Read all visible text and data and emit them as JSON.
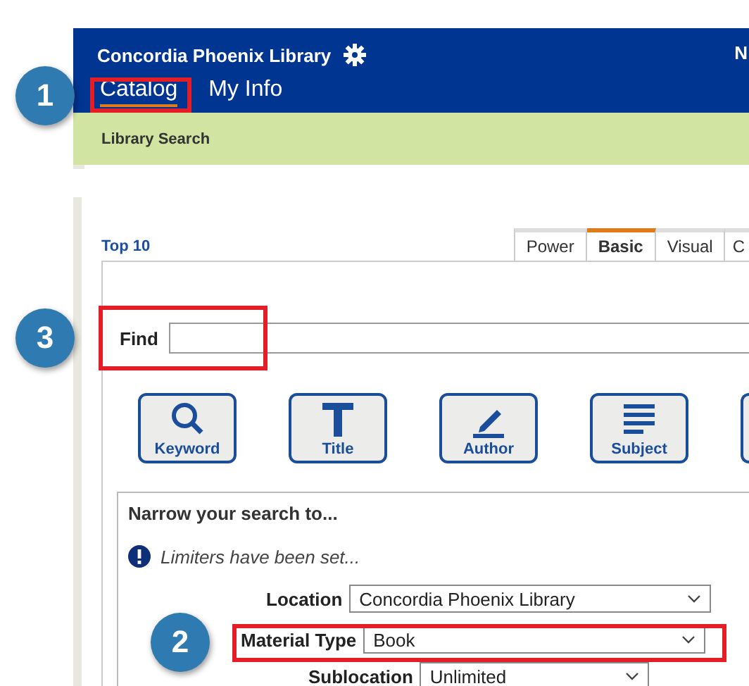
{
  "header": {
    "title": "Concordia Phoenix Library",
    "corner_text": "N"
  },
  "nav": [
    {
      "label": "Catalog",
      "selected": true
    },
    {
      "label": "My Info",
      "selected": false
    }
  ],
  "breadcrumb": "Library Search",
  "top_link": "Top 10",
  "tabs": [
    {
      "label": "Power",
      "selected": false
    },
    {
      "label": "Basic",
      "selected": true
    },
    {
      "label": "Visual",
      "selected": false
    },
    {
      "label": "C",
      "selected": false
    }
  ],
  "find": {
    "label": "Find"
  },
  "search_buttons": [
    {
      "label": "Keyword",
      "kind": "keyword"
    },
    {
      "label": "Title",
      "kind": "title"
    },
    {
      "label": "Author",
      "kind": "author"
    },
    {
      "label": "Subject",
      "kind": "subject"
    }
  ],
  "narrow": {
    "title": "Narrow your search to...",
    "notice": "Limiters have been set...",
    "limiters": [
      {
        "label": "Location",
        "value": "Concordia Phoenix Library"
      },
      {
        "label": "Material Type",
        "value": "Book"
      },
      {
        "label": "Sublocation",
        "value": "Unlimited"
      }
    ]
  },
  "callouts": [
    "1",
    "3",
    "2"
  ]
}
